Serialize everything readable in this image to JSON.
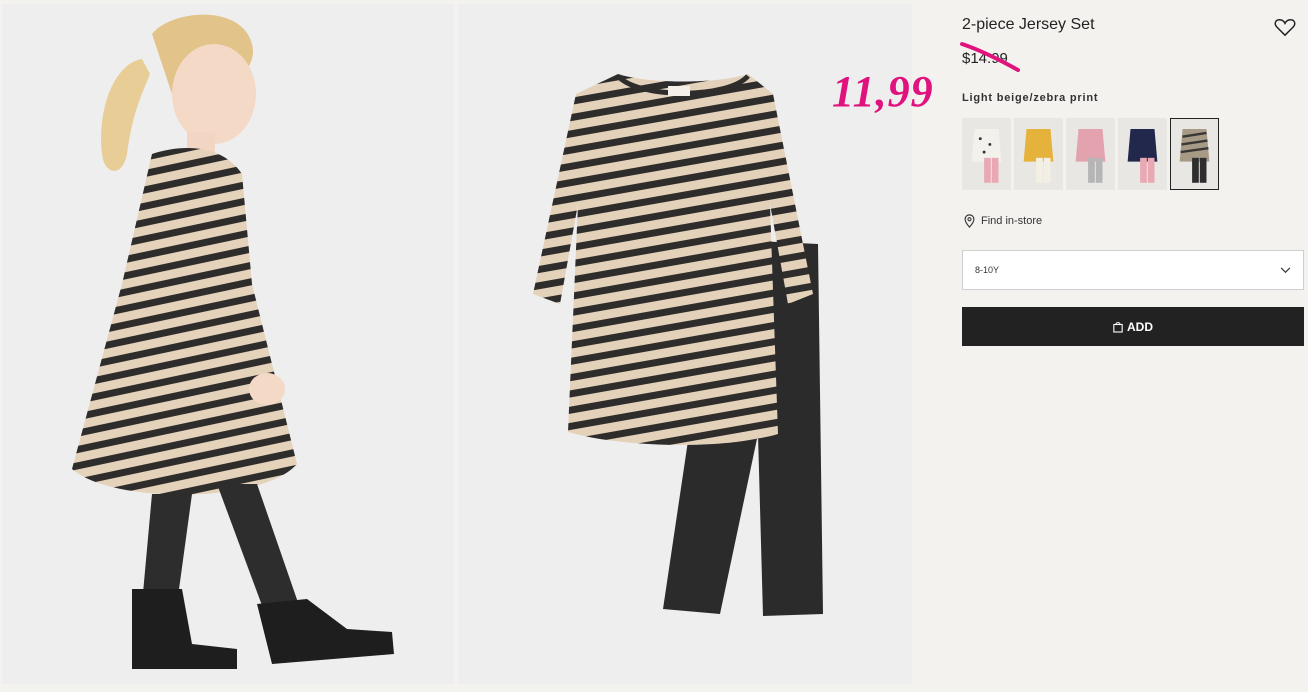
{
  "product": {
    "title": "2-piece Jersey Set",
    "old_price": "$14.99",
    "sale_price": "11,99",
    "color_name": "Light beige/zebra print",
    "find_in_store": "Find in-store",
    "size_value": "8-10Y",
    "add_label": "ADD"
  },
  "swatches": [
    {
      "name": "white-hearts",
      "top": "#f3f1ec",
      "bottom": "#e9a9b4"
    },
    {
      "name": "yellow",
      "top": "#e5b23c",
      "bottom": "#f3efe4"
    },
    {
      "name": "pink-print",
      "top": "#e3a3ae",
      "bottom": "#b5b5b5"
    },
    {
      "name": "navy-print",
      "top": "#22284c",
      "bottom": "#e9a9b4"
    },
    {
      "name": "zebra",
      "top": "#a79b86",
      "bottom": "#2e2e2e"
    }
  ],
  "colors": {
    "accent_sale": "#e0137e",
    "button": "#222222"
  },
  "icons": [
    "heart-icon",
    "location-pin-icon",
    "chevron-down-icon",
    "shopping-bag-icon"
  ]
}
